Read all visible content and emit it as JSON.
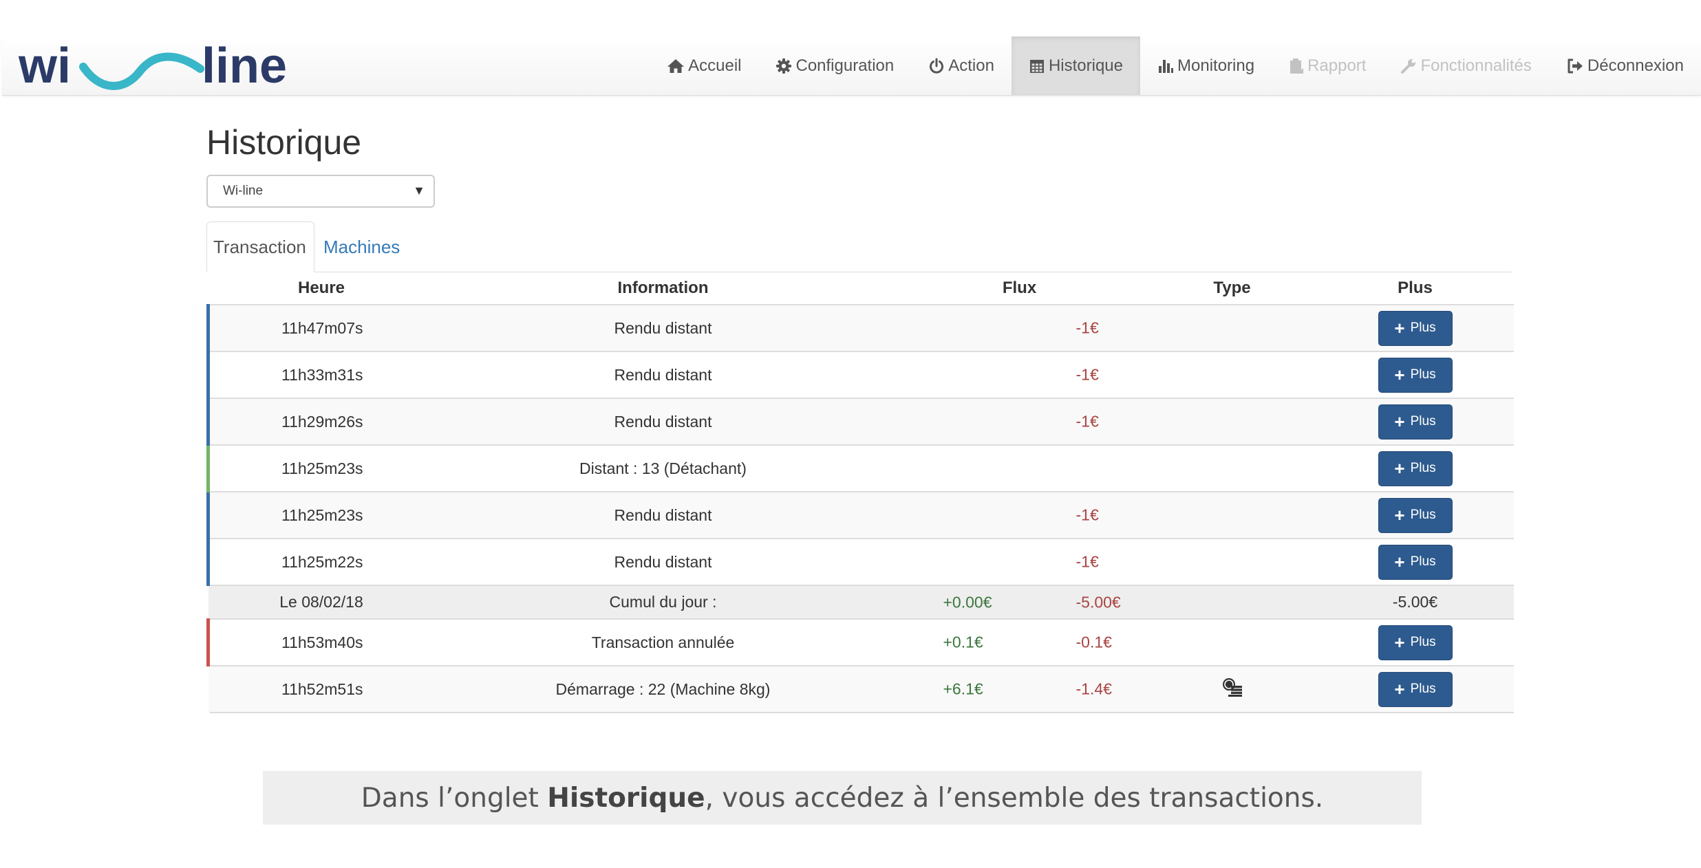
{
  "nav": {
    "items": [
      {
        "label": "Accueil",
        "icon": "home-icon",
        "state": "normal"
      },
      {
        "label": "Configuration",
        "icon": "gear-icon",
        "state": "normal"
      },
      {
        "label": "Action",
        "icon": "power-icon",
        "state": "normal"
      },
      {
        "label": "Historique",
        "icon": "calendar-icon",
        "state": "active"
      },
      {
        "label": "Monitoring",
        "icon": "bar-chart-icon",
        "state": "normal"
      },
      {
        "label": "Rapport",
        "icon": "clipboard-icon",
        "state": "disabled"
      },
      {
        "label": "Fonctionnalités",
        "icon": "wrench-icon",
        "state": "disabled"
      },
      {
        "label": "Déconnexion",
        "icon": "logout-icon",
        "state": "normal"
      }
    ]
  },
  "page": {
    "title": "Historique",
    "select_value": "Wi-line",
    "tabs": [
      "Transaction",
      "Machines"
    ]
  },
  "table": {
    "headers": {
      "heure": "Heure",
      "information": "Information",
      "flux": "Flux",
      "type": "Type",
      "plus": "Plus"
    },
    "button_label": "Plus",
    "rows": [
      {
        "heure": "11h47m07s",
        "information": "Rendu distant",
        "flux_pos": "",
        "flux_neg": "-1€",
        "type_icon": ""
      },
      {
        "heure": "11h33m31s",
        "information": "Rendu distant",
        "flux_pos": "",
        "flux_neg": "-1€",
        "type_icon": ""
      },
      {
        "heure": "11h29m26s",
        "information": "Rendu distant",
        "flux_pos": "",
        "flux_neg": "-1€",
        "type_icon": ""
      },
      {
        "heure": "11h25m23s",
        "information": "Distant : 13 (Détachant)",
        "flux_pos": "",
        "flux_neg": "",
        "type_icon": ""
      },
      {
        "heure": "11h25m23s",
        "information": "Rendu distant",
        "flux_pos": "",
        "flux_neg": "-1€",
        "type_icon": ""
      },
      {
        "heure": "11h25m22s",
        "information": "Rendu distant",
        "flux_pos": "",
        "flux_neg": "-1€",
        "type_icon": ""
      }
    ],
    "total": {
      "date": "Le 08/02/18",
      "label": "Cumul du jour :",
      "flux_pos": "+0.00€",
      "flux_neg": "-5.00€",
      "plus": "-5.00€"
    },
    "rows2": [
      {
        "heure": "11h53m40s",
        "information": "Transaction annulée",
        "flux_pos": "+0.1€",
        "flux_neg": "-0.1€",
        "type_icon": ""
      },
      {
        "heure": "11h52m51s",
        "information": "Démarrage : 22 (Machine 8kg)",
        "flux_pos": "+6.1€",
        "flux_neg": "-1.4€",
        "type_icon": "coin-stack-icon"
      }
    ]
  },
  "caption": {
    "before": "Dans l’onglet ",
    "bold": "Historique",
    "after": ", vous accédez à l’ensemble des transactions."
  },
  "colors": {
    "brand_navy": "#2b3a67",
    "brand_teal": "#39b6c8",
    "button": "#2e5b8f",
    "link": "#337ab7",
    "flux_positive": "#3c763d",
    "flux_negative": "#a94442",
    "row_blue": "#3a6fa8",
    "row_green": "#74b566",
    "row_red": "#c9534f"
  }
}
